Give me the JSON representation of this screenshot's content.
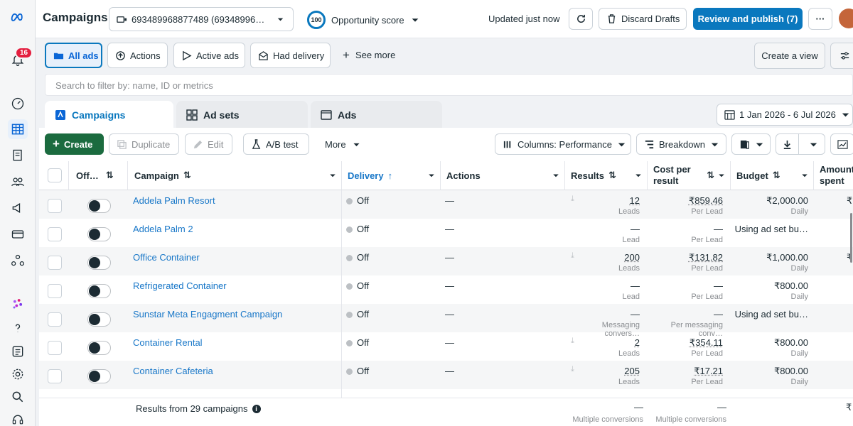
{
  "topbar": {
    "title": "Campaigns",
    "account": "693489968877489 (69348996…",
    "opportunity_score": "100",
    "opportunity_label": "Opportunity score",
    "updated": "Updated just now",
    "discard": "Discard Drafts",
    "review": "Review and publish (7)",
    "more": "···"
  },
  "nav": {
    "notifications": "16"
  },
  "filters": {
    "all_ads": "All ads",
    "actions": "Actions",
    "active_ads": "Active ads",
    "had_delivery": "Had delivery",
    "see_more": "See more",
    "create_view": "Create a view"
  },
  "search": {
    "placeholder": "Search to filter by: name, ID or metrics"
  },
  "tabs": {
    "campaigns": "Campaigns",
    "ad_sets": "Ad sets",
    "ads": "Ads"
  },
  "date_range": "1 Jan 2026 - 6 Jul 2026",
  "toolbar": {
    "create": "Create",
    "duplicate": "Duplicate",
    "edit": "Edit",
    "ab_test": "A/B test",
    "more": "More",
    "columns": "Columns: Performance",
    "breakdown": "Breakdown"
  },
  "table": {
    "headers": {
      "offon": "Off…",
      "campaign": "Campaign",
      "delivery": "Delivery",
      "actions": "Actions",
      "results": "Results",
      "cost_per_result_1": "Cost per",
      "cost_per_result_2": "result",
      "budget": "Budget",
      "amount_spent_1": "Amount",
      "amount_spent_2": "spent"
    },
    "rows": [
      {
        "name": "Addela Palm Resort",
        "delivery": "Off",
        "actions": "—",
        "results": "12",
        "results_sub": "Leads",
        "cost": "₹859.46",
        "cost_sub": "Per Lead",
        "budget": "₹2,000.00",
        "budget_sub": "Daily",
        "spent": "₹"
      },
      {
        "name": "Addela Palm 2",
        "delivery": "Off",
        "actions": "—",
        "results": "—",
        "results_sub": "Lead",
        "cost": "—",
        "cost_sub": "Per Lead",
        "budget": "Using ad set bu…",
        "budget_sub": "",
        "spent": ""
      },
      {
        "name": "Office Container",
        "delivery": "Off",
        "actions": "—",
        "results": "200",
        "results_sub": "Leads",
        "cost": "₹131.82",
        "cost_sub": "Per Lead",
        "budget": "₹1,000.00",
        "budget_sub": "Daily",
        "spent": "₹"
      },
      {
        "name": "Refrigerated Container",
        "delivery": "Off",
        "actions": "—",
        "results": "—",
        "results_sub": "Lead",
        "cost": "—",
        "cost_sub": "Per Lead",
        "budget": "₹800.00",
        "budget_sub": "Daily",
        "spent": ""
      },
      {
        "name": "Sunstar Meta Engagment Campaign",
        "delivery": "Off",
        "actions": "—",
        "results": "—",
        "results_sub": "Messaging convers…",
        "cost": "—",
        "cost_sub": "Per messaging conv…",
        "budget": "Using ad set bu…",
        "budget_sub": "",
        "spent": ""
      },
      {
        "name": "Container Rental",
        "delivery": "Off",
        "actions": "—",
        "results": "2",
        "results_sub": "Leads",
        "cost": "₹354.11",
        "cost_sub": "Per Lead",
        "budget": "₹800.00",
        "budget_sub": "Daily",
        "spent": ""
      },
      {
        "name": "Container Cafeteria",
        "delivery": "Off",
        "actions": "—",
        "results": "205",
        "results_sub": "Leads",
        "cost": "₹17.21",
        "cost_sub": "Per Lead",
        "budget": "₹800.00",
        "budget_sub": "Daily",
        "spent": ""
      }
    ],
    "footer": {
      "summary": "Results from 29 campaigns",
      "results": "—",
      "results_sub": "Multiple conversions",
      "cost": "—",
      "cost_sub": "Multiple conversions",
      "spent": "₹"
    }
  }
}
